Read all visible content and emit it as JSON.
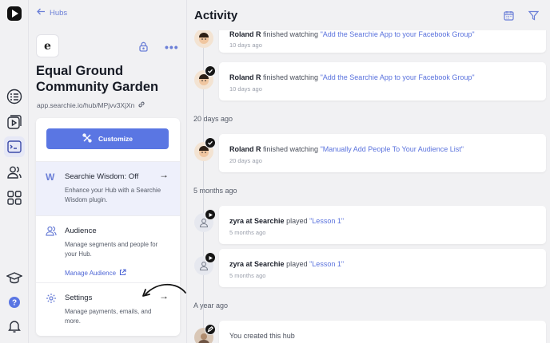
{
  "hub": {
    "back_label": "Hubs",
    "title": "Equal Ground Community Garden",
    "url": "app.searchie.io/hub/MPjvv3XjXn",
    "logo_letter": "e",
    "customize_label": "Customize",
    "sections": {
      "wisdom": {
        "title": "Searchie Wisdom: Off",
        "description": "Enhance your Hub with a Searchie Wisdom plugin."
      },
      "audience": {
        "title": "Audience",
        "description": "Manage segments and people for your Hub.",
        "link": "Manage Audience"
      },
      "settings": {
        "title": "Settings",
        "description": "Manage payments, emails, and more."
      }
    }
  },
  "activity": {
    "title": "Activity",
    "dates": [
      "20 days ago",
      "5 months ago",
      "A year ago"
    ],
    "items": [
      {
        "user": "Roland R",
        "verb": "finished watching",
        "target": "\"Add the Searchie App to your Facebook Group\"",
        "time": "10 days ago"
      },
      {
        "user": "Roland R",
        "verb": "finished watching",
        "target": "\"Add the Searchie App to your Facebook Group\"",
        "time": "10 days ago"
      },
      {
        "user": "Roland R",
        "verb": "finished watching",
        "target": "\"Manually Add People To Your Audience List\"",
        "time": "20 days ago"
      },
      {
        "user": "zyra at Searchie",
        "verb": "played",
        "target": "\"Lesson 1\"",
        "time": "5 months ago"
      },
      {
        "user": "zyra at Searchie",
        "verb": "played",
        "target": "\"Lesson 1\"",
        "time": "5 months ago"
      },
      {
        "text": "You created this hub"
      }
    ]
  },
  "colors": {
    "accent": "#5a76e3",
    "link": "#5a72dd",
    "wisdom_bg": "#eef0fb"
  },
  "icons": [
    "app-logo-icon",
    "checklist-icon",
    "video-library-icon",
    "hub-icon",
    "people-icon",
    "grid-icon",
    "graduation-cap-icon",
    "help-icon",
    "bell-icon",
    "calendar-icon",
    "filter-icon",
    "lock-icon",
    "more-icon"
  ]
}
